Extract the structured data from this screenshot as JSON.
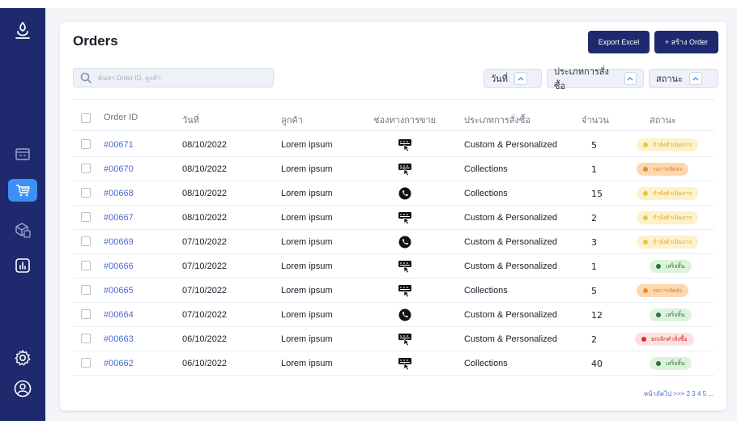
{
  "app": {
    "page_title": "Orders",
    "export_label": "Export Excel",
    "create_label": "+ สร้าง Order"
  },
  "search": {
    "placeholder": "ค้นหา Order ID, ลูกค้า"
  },
  "filters": [
    {
      "label": "วันที่"
    },
    {
      "label": "ประเภทการสั่งซื้อ"
    },
    {
      "label": "สถานะ"
    }
  ],
  "columns": {
    "order_id": "Order ID",
    "date": "วันที่",
    "customer": "ลูกค้า",
    "channel": "ช่องทางการขาย",
    "order_type": "ประเภทการสั่งซื้อ",
    "quantity": "จำนวน",
    "status": "สถานะ"
  },
  "rows": [
    {
      "id": "#00671",
      "date": "08/10/2022",
      "customer": "Lorem ipsum",
      "channel": "web-icon",
      "type": "Custom & Personalized",
      "qty": "5",
      "status": "กำลังดำเนินการ",
      "status_kind": "processing"
    },
    {
      "id": "#00670",
      "date": "08/10/2022",
      "customer": "Lorem ipsum",
      "channel": "web-icon",
      "type": "Collections",
      "qty": "1",
      "status": "รอการจัดส่ง",
      "status_kind": "shipping"
    },
    {
      "id": "#00668",
      "date": "08/10/2022",
      "customer": "Lorem ipsum",
      "channel": "phone-icon",
      "type": "Collections",
      "qty": "15",
      "status": "กำลังดำเนินการ",
      "status_kind": "processing"
    },
    {
      "id": "#00667",
      "date": "08/10/2022",
      "customer": "Lorem ipsum",
      "channel": "web-icon",
      "type": "Custom & Personalized",
      "qty": "2",
      "status": "กำลังดำเนินการ",
      "status_kind": "processing"
    },
    {
      "id": "#00669",
      "date": "07/10/2022",
      "customer": "Lorem ipsum",
      "channel": "phone-icon",
      "type": "Custom & Personalized",
      "qty": "3",
      "status": "กำลังดำเนินการ",
      "status_kind": "processing"
    },
    {
      "id": "#00666",
      "date": "07/10/2022",
      "customer": "Lorem ipsum",
      "channel": "web-icon",
      "type": "Custom & Personalized",
      "qty": "1",
      "status": "เสร็จสิ้น",
      "status_kind": "done"
    },
    {
      "id": "#00665",
      "date": "07/10/2022",
      "customer": "Lorem ipsum",
      "channel": "web-icon",
      "type": "Collections",
      "qty": "5",
      "status": "รอการจัดส่ง",
      "status_kind": "shipping"
    },
    {
      "id": "#00664",
      "date": "07/10/2022",
      "customer": "Lorem ipsum",
      "channel": "phone-icon",
      "type": "Custom & Personalized",
      "qty": "12",
      "status": "เสร็จสิ้น",
      "status_kind": "done"
    },
    {
      "id": "#00663",
      "date": "06/10/2022",
      "customer": "Lorem ipsum",
      "channel": "web-icon",
      "type": "Custom & Personalized",
      "qty": "2",
      "status": "ยกเลิกคำสั่งซื้อ",
      "status_kind": "cancelled"
    },
    {
      "id": "#00662",
      "date": "06/10/2022",
      "customer": "Lorem ipsum",
      "channel": "web-icon",
      "type": "Collections",
      "qty": "40",
      "status": "เสร็จสิ้น",
      "status_kind": "done"
    }
  ],
  "status_colors": {
    "processing": {
      "bg": "#fdf1c9",
      "dot": "#f2c23c",
      "text": "#d9a520"
    },
    "shipping": {
      "bg": "#fcd8b0",
      "dot": "#f08a24",
      "text": "#e07a18"
    },
    "done": {
      "bg": "#dff2dc",
      "dot": "#1f7a36",
      "text": "#1f7a36"
    },
    "cancelled": {
      "bg": "#fde1e1",
      "dot": "#e02424",
      "text": "#d12020"
    }
  },
  "pagination": {
    "text": "หน้าถัดไป >>> 2 3 4 5 ..."
  },
  "sidebar_icons": [
    "logo-icon",
    "store-icon",
    "cart-icon",
    "box-icon",
    "chart-icon",
    "gear-icon",
    "user-icon"
  ],
  "colors": {
    "sidebar": "#1e2a6d",
    "accent": "#3d8ff5",
    "button": "#1e2a6d"
  }
}
